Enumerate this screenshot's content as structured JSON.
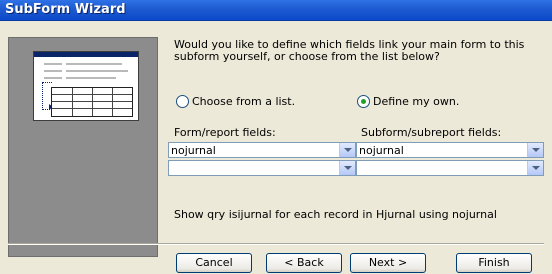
{
  "window": {
    "title": "SubForm Wizard"
  },
  "illustration": {
    "icon": "form-subform-illustration"
  },
  "question": "Would you like to define which fields link your main form to this subform yourself, or choose from the list below?",
  "options": {
    "choose_from_list": {
      "label": "Choose from a list.",
      "selected": false
    },
    "define_my_own": {
      "label": "Define my own.",
      "selected": true
    }
  },
  "fields": {
    "form_label": "Form/report fields:",
    "subform_label": "Subform/subreport fields:",
    "form_values": [
      "nojurnal",
      ""
    ],
    "subform_values": [
      "nojurnal",
      ""
    ]
  },
  "summary": "Show qry isijurnal for each record in Hjurnal using nojurnal",
  "buttons": {
    "cancel": "Cancel",
    "back": "< Back",
    "next": "Next >",
    "finish": "Finish"
  },
  "colors": {
    "titlebar": "#0a49c9",
    "dialog": "#ece9d8",
    "radio_checked": "#21a121"
  }
}
